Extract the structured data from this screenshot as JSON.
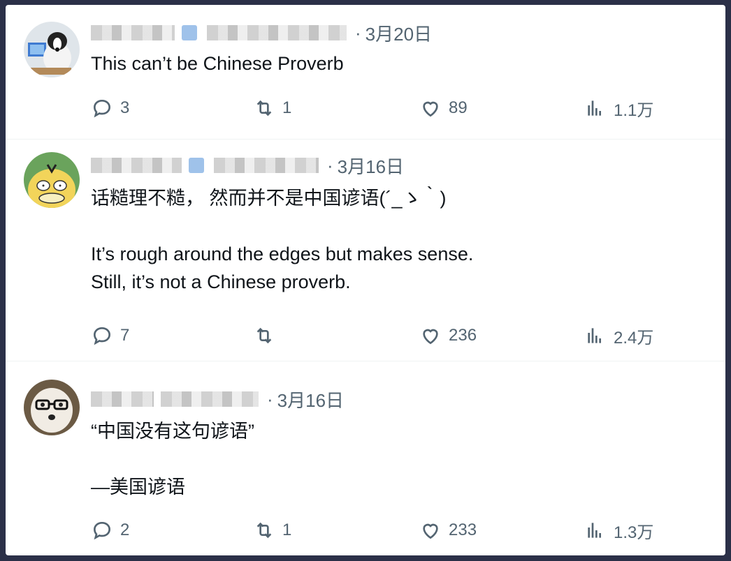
{
  "tweets": [
    {
      "date": "3月20日",
      "separator": "·",
      "text": "This can’t be Chinese Proverb",
      "replies": "3",
      "retweets": "1",
      "likes": "89",
      "views": "1.1万"
    },
    {
      "date": "3月16日",
      "separator": "·",
      "text": "话糙理不糙， 然而并不是中国谚语(´_ゝ｀)\n\nIt’s rough around the edges but makes sense.\nStill, it’s not a Chinese proverb.",
      "replies": "7",
      "retweets": "",
      "likes": "236",
      "views": "2.4万"
    },
    {
      "date": "3月16日",
      "separator": "·",
      "text": "“中国没有这句谚语”\n\n—美国谚语",
      "replies": "2",
      "retweets": "1",
      "likes": "233",
      "views": "1.3万"
    }
  ],
  "colors": {
    "text": "#0f1419",
    "muted": "#536471",
    "background": "#ffffff",
    "frame": "#2b3048"
  },
  "icons": [
    "reply-icon",
    "retweet-icon",
    "like-icon",
    "views-icon"
  ]
}
